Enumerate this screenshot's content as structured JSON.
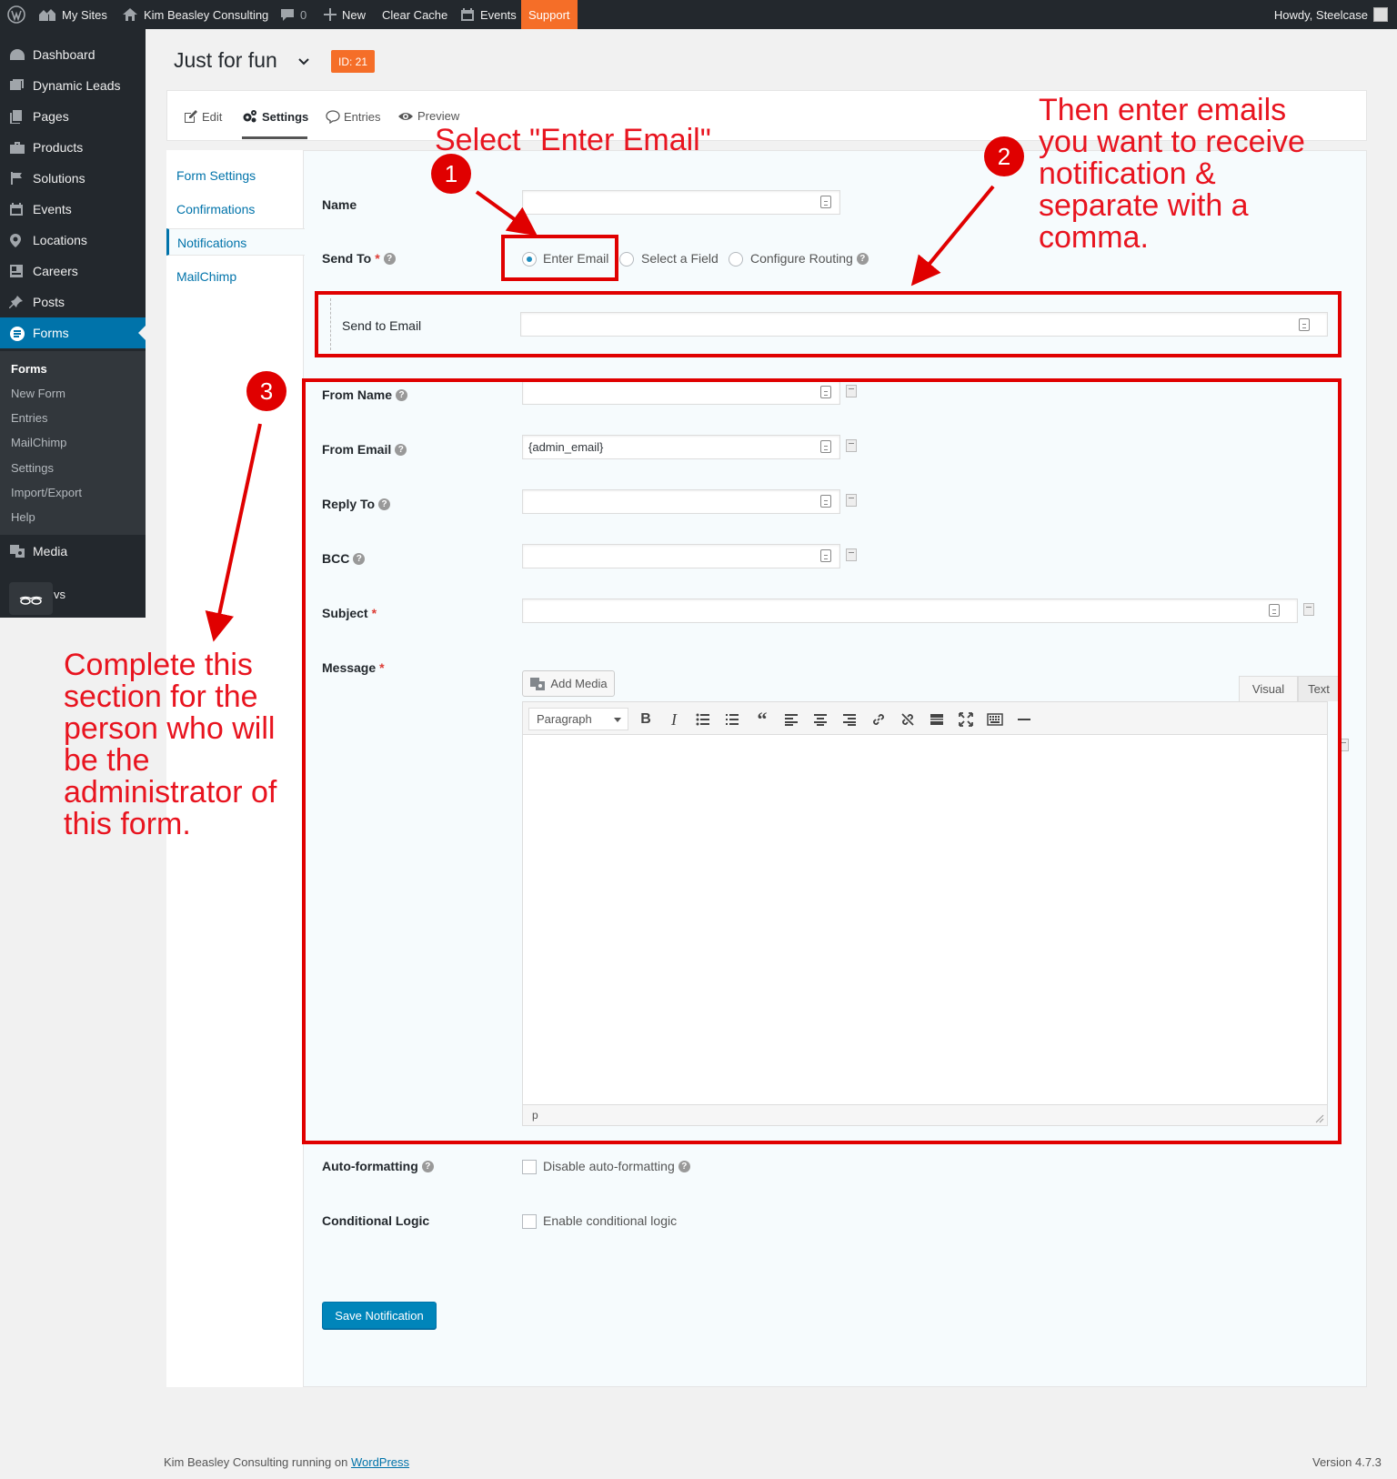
{
  "admin_bar": {
    "my_sites": "My Sites",
    "site_name": "Kim Beasley Consulting",
    "comments_count": "0",
    "new": "New",
    "clear_cache": "Clear Cache",
    "events": "Events",
    "support": "Support",
    "howdy": "Howdy, Steelcase"
  },
  "sidebar": {
    "items": [
      {
        "label": "Dashboard",
        "icon": "dashboard-icon"
      },
      {
        "label": "Dynamic Leads",
        "icon": "dynamic-leads-icon"
      },
      {
        "label": "Pages",
        "icon": "pages-icon"
      },
      {
        "label": "Products",
        "icon": "products-icon"
      },
      {
        "label": "Solutions",
        "icon": "solutions-icon"
      },
      {
        "label": "Events",
        "icon": "events-icon"
      },
      {
        "label": "Locations",
        "icon": "locations-icon"
      },
      {
        "label": "Careers",
        "icon": "careers-icon"
      },
      {
        "label": "Posts",
        "icon": "posts-icon"
      },
      {
        "label": "Forms",
        "icon": "forms-icon"
      },
      {
        "label": "Media",
        "icon": "media-icon"
      }
    ],
    "submenu": [
      "Forms",
      "New Form",
      "Entries",
      "MailChimp",
      "Settings",
      "Import/Export",
      "Help"
    ],
    "truncated_item": "vs",
    "active_color": "#0073aa"
  },
  "header": {
    "form_title": "Just for fun",
    "id_badge": "ID: 21",
    "tabs": [
      "Edit",
      "Settings",
      "Entries",
      "Preview"
    ],
    "active_tab": "Settings"
  },
  "subnav": {
    "items": [
      "Form Settings",
      "Confirmations",
      "Notifications",
      "MailChimp"
    ],
    "active": "Notifications"
  },
  "form": {
    "name_label": "Name",
    "send_to_label": "Send To",
    "required_mark": "*",
    "send_to_options": [
      "Enter Email",
      "Select a Field",
      "Configure Routing"
    ],
    "send_to_selected": "Enter Email",
    "send_to_email_label": "Send to Email",
    "from_name_label": "From Name",
    "from_email_label": "From Email",
    "from_email_value": "{admin_email}",
    "reply_to_label": "Reply To",
    "bcc_label": "BCC",
    "subject_label": "Subject",
    "message_label": "Message",
    "add_media": "Add Media",
    "editor_tabs": [
      "Visual",
      "Text"
    ],
    "format_select": "Paragraph",
    "editor_path": "p",
    "auto_formatting_label": "Auto-formatting",
    "disable_auto_formatting": "Disable auto-formatting",
    "conditional_logic_label": "Conditional Logic",
    "enable_conditional_logic": "Enable conditional logic",
    "save_button": "Save Notification",
    "help_icon_glyph": "?"
  },
  "footer": {
    "text": "Kim Beasley Consulting running on",
    "link": "WordPress",
    "version": "Version 4.7.3"
  },
  "annotations": {
    "marker_1": "1",
    "marker_2": "2",
    "marker_3": "3",
    "select_text": "Select \"Enter Email\"",
    "emails_text": [
      "Then enter emails",
      "you want to receive",
      "notification &",
      "separate with a",
      "comma."
    ],
    "complete_text": [
      "Complete this",
      "section for the",
      "person who will",
      "be the",
      "administrator of",
      "this form."
    ],
    "color": "#e00000"
  }
}
